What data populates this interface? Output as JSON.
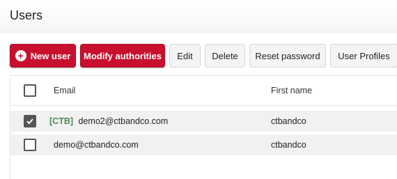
{
  "header": {
    "title": "Users"
  },
  "toolbar": {
    "new_user_label": "New user",
    "new_user_icon": "plus-circle-icon",
    "modify_authorities_label": "Modify authorities",
    "edit_label": "Edit",
    "delete_label": "Delete",
    "reset_password_label": "Reset password",
    "user_profiles_label": "User Profiles"
  },
  "table": {
    "columns": {
      "email": "Email",
      "first_name": "First name"
    },
    "rows": [
      {
        "selected": true,
        "tag": "[CTB]",
        "email": "demo2@ctbandco.com",
        "first_name": "ctbandco"
      },
      {
        "selected": false,
        "tag": "",
        "email": "demo@ctbandco.com",
        "first_name": "ctbandco"
      }
    ]
  },
  "colors": {
    "primary": "#c8102e",
    "tag": "#4a8b57",
    "checkbox": "#555555",
    "row_bg": "#f1f1f1"
  }
}
